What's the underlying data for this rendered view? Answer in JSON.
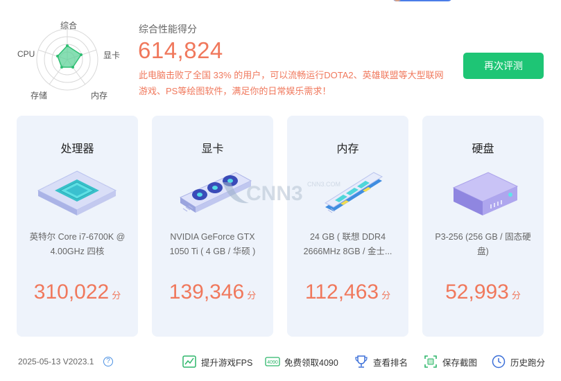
{
  "radar": {
    "labels": {
      "top": "综合",
      "right": "显卡",
      "bottom_right": "内存",
      "bottom_left": "存储",
      "left": "CPU"
    }
  },
  "summary": {
    "title": "综合性能得分",
    "score": "614,824",
    "description": "此电脑击败了全国 33% 的用户，可以流畅运行DOTA2、英雄联盟等大型联网游戏、PS等绘图软件，满足你的日常娱乐需求！"
  },
  "retest_button": {
    "label": "再次评测"
  },
  "cards": [
    {
      "title": "处理器",
      "desc": "英特尔 Core i7-6700K @ 4.00GHz 四核",
      "score": "310,022",
      "unit": "分",
      "icon": "cpu-chip-icon"
    },
    {
      "title": "显卡",
      "desc": "NVIDIA GeForce GTX 1050 Ti ( 4 GB / 华硕 )",
      "score": "139,346",
      "unit": "分",
      "icon": "graphics-card-icon"
    },
    {
      "title": "内存",
      "desc": "24 GB ( 联想 DDR4 2666MHz 8GB / 金士...",
      "score": "112,463",
      "unit": "分",
      "icon": "memory-stick-icon"
    },
    {
      "title": "硬盘",
      "desc": "P3-256 (256 GB / 固态硬盘)",
      "score": "52,993",
      "unit": "分",
      "icon": "hard-drive-icon"
    }
  ],
  "watermark": {
    "text": "CNN3",
    "subtext": "CNN3.COM"
  },
  "footer": {
    "version": "2025-05-13 V2023.1",
    "help": "?",
    "links": [
      {
        "label": "提升游戏FPS",
        "icon": "game-fps-icon"
      },
      {
        "label": "免费领取4090",
        "icon": "gpu-4090-icon",
        "badge": "4090"
      },
      {
        "label": "查看排名",
        "icon": "trophy-icon"
      },
      {
        "label": "保存截图",
        "icon": "screenshot-icon"
      },
      {
        "label": "历史跑分",
        "icon": "history-clock-icon"
      }
    ]
  },
  "colors": {
    "accent_orange": "#f0785c",
    "button_green": "#1ec575",
    "radar_fill": "#5fd39a",
    "card_bg": "#eef3fb"
  }
}
